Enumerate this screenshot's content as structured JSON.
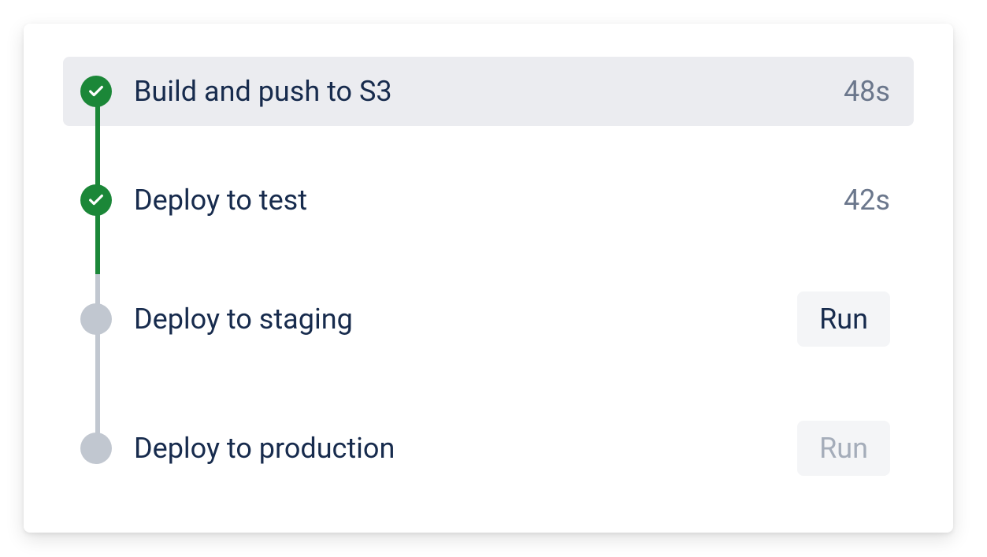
{
  "pipeline": {
    "steps": [
      {
        "name": "Build and push to S3",
        "status": "success",
        "duration": "48s",
        "selected": true
      },
      {
        "name": "Deploy to test",
        "status": "success",
        "duration": "42s",
        "selected": false
      },
      {
        "name": "Deploy to staging",
        "status": "pending",
        "action_label": "Run",
        "action_enabled": true,
        "selected": false
      },
      {
        "name": "Deploy to production",
        "status": "pending",
        "action_label": "Run",
        "action_enabled": false,
        "selected": false
      }
    ]
  },
  "colors": {
    "success": "#1b8738",
    "pending": "#c1c7d0",
    "text_primary": "#172b4d",
    "text_muted": "#6b778c",
    "bg_selected": "#ebecf0",
    "btn_bg": "#f4f5f7"
  }
}
